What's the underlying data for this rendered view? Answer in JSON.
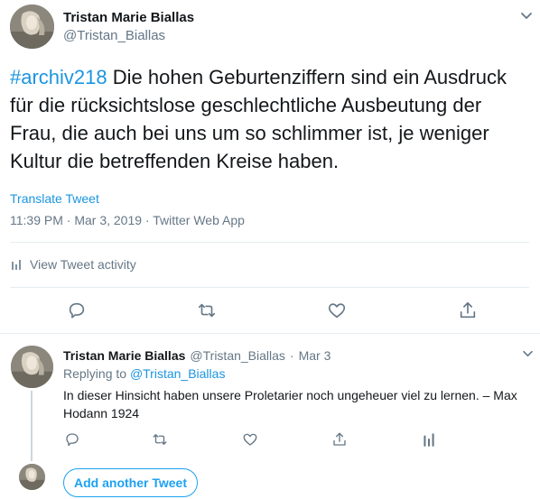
{
  "main_tweet": {
    "author_name": "Tristan Marie Biallas",
    "author_handle": "@Tristan_Biallas",
    "hashtag": "#archiv218",
    "text": " Die hohen Geburtenziffern sind ein Ausdruck für die rücksichtslose geschlechtliche Ausbeutung der Frau, die auch bei uns um so schlimmer ist, je weniger Kultur die betreffenden Kreise haben.",
    "translate_label": "Translate Tweet",
    "timestamp": "11:39 PM · Mar 3, 2019 · Twitter Web App",
    "activity_label": "View Tweet activity",
    "icons": {
      "menu": "chevron-down-icon",
      "activity": "bar-chart-icon",
      "reply": "reply-icon",
      "retweet": "retweet-icon",
      "like": "heart-icon",
      "share": "share-icon"
    }
  },
  "reply_tweet": {
    "author_name": "Tristan Marie Biallas",
    "author_handle": "@Tristan_Biallas",
    "separator": "·",
    "date": "Mar 3",
    "replying_to_prefix": "Replying to ",
    "replying_to_handle": "@Tristan_Biallas",
    "text": "In dieser Hinsicht haben unsere Proletarier noch ungeheuer viel zu lernen. – Max Hodann 1924"
  },
  "composer": {
    "add_button_label": "Add another Tweet"
  },
  "colors": {
    "accent": "#1da1f2",
    "link": "#1b95e0",
    "secondary_text": "#657786",
    "divider": "#e6ecf0"
  }
}
